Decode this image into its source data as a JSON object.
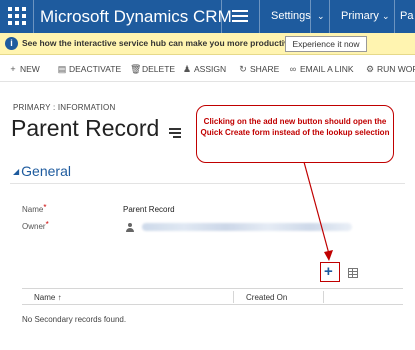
{
  "topnav": {
    "brand": "Microsoft Dynamics CRM",
    "settings": "Settings",
    "area": "Primary",
    "overflow": "Pa",
    "color": "#1e5b9e"
  },
  "notification": {
    "message": "See how the interactive service hub can make you more productive.",
    "button": "Experience it now"
  },
  "commands": {
    "new": "NEW",
    "deactivate": "DEACTIVATE",
    "delete": "DELETE",
    "assign": "ASSIGN",
    "share": "SHARE",
    "email_link": "EMAIL A LINK",
    "run_workflow": "RUN WOR"
  },
  "header": {
    "breadcrumb": "PRIMARY : INFORMATION",
    "title": "Parent Record"
  },
  "section": {
    "title": "General"
  },
  "fields": {
    "name_label": "Name",
    "name_value": "Parent Record",
    "owner_label": "Owner",
    "required_mark": "*"
  },
  "callout": {
    "text": "Clicking on the add new button should open the Quick Create form instead of the lookup selection"
  },
  "subgrid": {
    "columns": [
      "Name ↑",
      "Created On"
    ],
    "empty_message": "No Secondary records found."
  }
}
